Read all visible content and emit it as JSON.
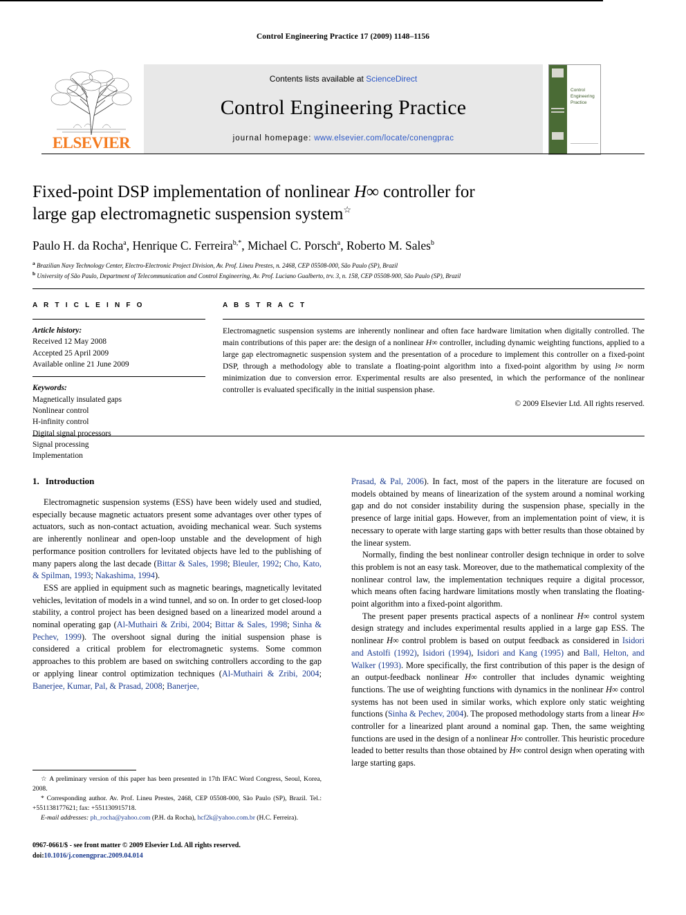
{
  "running_head": "Control Engineering Practice 17 (2009) 1148–1156",
  "masthead": {
    "contents_prefix": "Contents lists available at ",
    "sciencedirect": "ScienceDirect",
    "journal_title": "Control Engineering Practice",
    "homepage_label": "journal homepage:",
    "homepage_url": "www.elsevier.com/locate/conengprac",
    "publisher": "ELSEVIER",
    "cover_title": "Control Engineering Practice",
    "accent_orange": "#F47B20",
    "link_blue": "#2a56c6",
    "cover_green": "#4a6b35"
  },
  "title": {
    "line1_a": "Fixed-point DSP implementation of nonlinear ",
    "line1_math": "H∞",
    "line1_b": " controller for",
    "line2": "large gap electromagnetic suspension system",
    "footnote_marker": "☆"
  },
  "authors": [
    {
      "name": "Paulo H. da Rocha",
      "marks": "a"
    },
    {
      "name": "Henrique C. Ferreira",
      "marks": "b,*"
    },
    {
      "name": "Michael C. Porsch",
      "marks": "a"
    },
    {
      "name": "Roberto M. Sales",
      "marks": "b"
    }
  ],
  "affiliations": [
    {
      "mark": "a",
      "text": "Brazilian Navy Technology Center, Electro-Electronic Project Division, Av. Prof. Lineu Prestes, n. 2468, CEP 05508-000, São Paulo (SP), Brazil"
    },
    {
      "mark": "b",
      "text": "University of São Paulo, Department of Telecommunication and Control Engineering, Av. Prof. Luciano Gualberto, trv. 3, n. 158, CEP 05508-900, São Paulo (SP), Brazil"
    }
  ],
  "article_info": {
    "heading": "A R T I C L E   I N F O",
    "history_label": "Article history:",
    "history": [
      "Received 12 May 2008",
      "Accepted 25 April 2009",
      "Available online 21 June 2009"
    ],
    "keywords_label": "Keywords:",
    "keywords": [
      "Magnetically insulated gaps",
      "Nonlinear control",
      "H-infinity control",
      "Digital signal processors",
      "Signal processing",
      "Implementation"
    ]
  },
  "abstract": {
    "heading": "A B S T R A C T",
    "p1_a": "Electromagnetic suspension systems are inherently nonlinear and often face hardware limitation when digitally controlled. The main contributions of this paper are: the design of a nonlinear ",
    "p1_math1": "H∞",
    "p1_b": " controller, including dynamic weighting functions, applied to a large gap electromagnetic suspension system and the presentation of a procedure to implement this controller on a fixed-point DSP, through a methodology able to translate a floating-point algorithm into a fixed-point algorithm by using ",
    "p1_math2": "l∞",
    "p1_c": " norm minimization due to conversion error. Experimental results are also presented, in which the performance of the nonlinear controller is evaluated specifically in the initial suspension phase.",
    "copyright": "© 2009 Elsevier Ltd. All rights reserved."
  },
  "introduction": {
    "number": "1.",
    "heading": "Introduction",
    "left": {
      "p1_a": "Electromagnetic suspension systems (ESS) have been widely used and studied, especially because magnetic actuators present some advantages over other types of actuators, such as non-contact actuation, avoiding mechanical wear. Such systems are inherently nonlinear and open-loop unstable and the development of high performance position controllers for levitated objects have led to the publishing of many papers along the last decade (",
      "p1_cite1": "Bittar & Sales, 1998",
      "p1_sep1": "; ",
      "p1_cite2": "Bleuler, 1992",
      "p1_sep2": "; ",
      "p1_cite3": "Cho, Kato, & Spilman, 1993",
      "p1_sep3": "; ",
      "p1_cite4": "Nakashima, 1994",
      "p1_end": ").",
      "p2_a": "ESS are applied in equipment such as magnetic bearings, magnetically levitated vehicles, levitation of models in a wind tunnel, and so on. In order to get closed-loop stability, a control project has been designed based on a linearized model around a nominal operating gap (",
      "p2_cite1": "Al-Muthairi & Zribi, 2004",
      "p2_sep1": "; ",
      "p2_cite2": "Bittar & Sales, 1998",
      "p2_sep2": "; ",
      "p2_cite3": "Sinha & Pechev, 1999",
      "p2_b": "). The overshoot signal during the initial suspension phase is considered a critical problem for electromagnetic systems. Some common approaches to this problem are based on switching controllers according to the gap or applying linear control optimization techniques (",
      "p2_cite4": "Al-Muthairi & Zribi, 2004",
      "p2_sep3": "; ",
      "p2_cite5": "Banerjee, Kumar, Pal, & Prasad, 2008",
      "p2_sep4": "; ",
      "p2_cite6": "Banerjee,"
    },
    "right": {
      "p2_cont_cite": "Prasad, & Pal, 2006",
      "p2_cont": "). In fact, most of the papers in the literature are focused on models obtained by means of linearization of the system around a nominal working gap and do not consider instability during the suspension phase, specially in the presence of large initial gaps. However, from an implementation point of view, it is necessary to operate with large starting gaps with better results than those obtained by the linear system.",
      "p3": "Normally, finding the best nonlinear controller design technique in order to solve this problem is not an easy task. Moreover, due to the mathematical complexity of the nonlinear control law, the implementation techniques require a digital processor, which means often facing hardware limitations mostly when translating the floating-point algorithm into a fixed-point algorithm.",
      "p4_a": "The present paper presents practical aspects of a nonlinear ",
      "p4_math1": "H∞",
      "p4_b": " control system design strategy and includes experimental results applied in a large gap ESS. The nonlinear ",
      "p4_math2": "H∞",
      "p4_c": " control problem is based on output feedback as considered in ",
      "p4_cite1": "Isidori and Astolfi (1992)",
      "p4_d": ", ",
      "p4_cite2": "Isidori (1994)",
      "p4_e": ", ",
      "p4_cite3": "Isidori and Kang (1995)",
      "p4_f": " and ",
      "p4_cite4": "Ball, Helton, and Walker (1993)",
      "p4_g": ". More specifically, the first contribution of this paper is the design of an output-feedback nonlinear ",
      "p4_math3": "H∞",
      "p4_h": " controller that includes dynamic weighting functions. The use of weighting functions with dynamics in the nonlinear ",
      "p4_math4": "H∞",
      "p4_i": " control systems has not been used in similar works, which explore only static weighting functions (",
      "p4_cite5": "Sinha & Pechev, 2004",
      "p4_j": "). The proposed methodology starts from a linear ",
      "p4_math5": "H∞",
      "p4_k": " controller for a linearized plant around a nominal gap. Then, the same weighting functions are used in the design of a nonlinear ",
      "p4_math6": "H∞",
      "p4_l": " controller. This heuristic procedure leaded to better results than those obtained by ",
      "p4_math7": "H∞",
      "p4_m": " control design when operating with large starting gaps."
    }
  },
  "footnotes": {
    "star_marker": "☆",
    "star_text": " A preliminary version of this paper has been presented in 17th IFAC Word Congress, Seoul, Korea, 2008.",
    "corr_marker": "*",
    "corr_text": " Corresponding author. Av. Prof. Lineu Prestes, 2468, CEP 05508-000, São Paulo (SP), Brazil. Tel.: +551138177621; fax: +551130915718.",
    "email_label": "E-mail addresses:",
    "email1": "ph_rocha@yahoo.com",
    "email1_owner": " (P.H. da Rocha), ",
    "email2": "hcf2k@yahoo.com.br",
    "email2_owner": " (H.C. Ferreira)."
  },
  "imprint": {
    "issn_line": "0967-0661/$ - see front matter © 2009 Elsevier Ltd. All rights reserved.",
    "doi_label": "doi:",
    "doi_value": "10.1016/j.conengprac.2009.04.014"
  }
}
